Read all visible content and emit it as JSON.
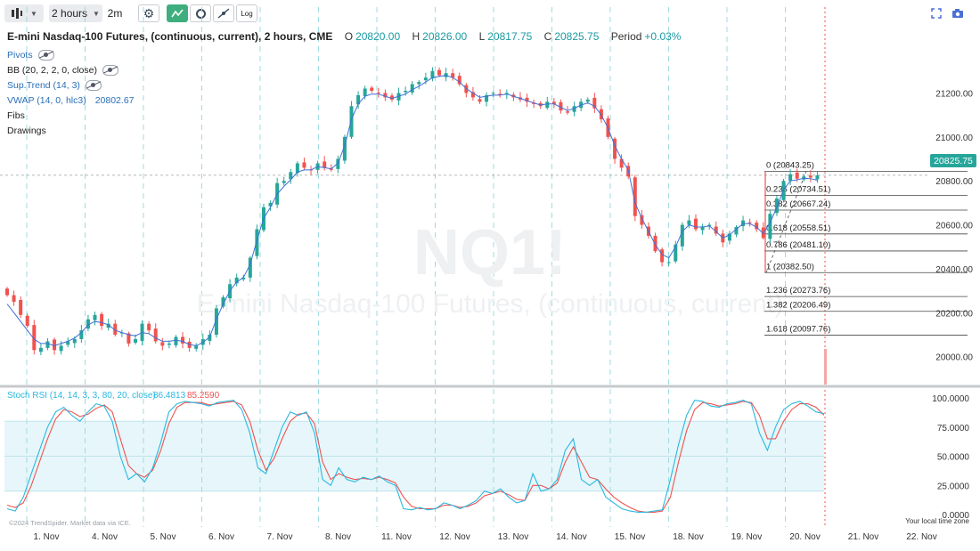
{
  "toolbar": {
    "interval": "2 hours",
    "refresh": "2m",
    "log_label": "Log"
  },
  "header": {
    "title": "E-mini Nasdaq-100 Futures, (continuous, current), 2 hours, CME",
    "o_label": "O",
    "o_value": "20820.00",
    "h_label": "H",
    "h_value": "20826.00",
    "l_label": "L",
    "l_value": "20817.75",
    "c_label": "C",
    "c_value": "20825.75",
    "period_label": "Period",
    "period_value": "+0.03%"
  },
  "indicators": {
    "pivots": "Pivots",
    "bb": "BB (20, 2, 2, 0, close)",
    "supertrend": "Sup.Trend (14, 3)",
    "vwap": "VWAP (14, 0, hlc3)",
    "vwap_value": "20802.67",
    "fibs": "Fibs",
    "drawings": "Drawings"
  },
  "watermark": {
    "symbol": "NQ1!",
    "name": "E-mini Nasdaq-100 Futures, (continuous, current)"
  },
  "price_label": "20825.75",
  "stoch_legend": {
    "text": "Stoch RSI (14, 14, 3, 3, 80, 20, close)",
    "k_value": "86.4813",
    "d_value": "85.2590"
  },
  "copyright": "©2024 TrendSpider. Market data via ICE.",
  "timezone_note": "Your local time zone",
  "colors": {
    "up": "#26a69a",
    "down": "#ef5350",
    "vwap": "#3f6fd6",
    "stoch_k": "#2ab8e0",
    "stoch_d": "#ef5350",
    "band_fill": "#e6f6fa",
    "accent": "#3fae7e"
  },
  "chart_data": {
    "type": "candlestick",
    "x_ticks": [
      "1. Nov",
      "4. Nov",
      "5. Nov",
      "6. Nov",
      "7. Nov",
      "8. Nov",
      "11. Nov",
      "12. Nov",
      "13. Nov",
      "14. Nov",
      "15. Nov",
      "18. Nov",
      "19. Nov",
      "20. Nov",
      "21. Nov",
      "22. Nov"
    ],
    "price_ticks": [
      "21200.00",
      "21000.00",
      "20800.00",
      "20600.00",
      "20400.00",
      "20200.00",
      "20000.00"
    ],
    "ylim": [
      19930,
      21380
    ],
    "last_price": 20825.75,
    "series": [
      {
        "name": "Price",
        "values": [
          20280,
          20250,
          20190,
          20140,
          20030,
          20040,
          20070,
          20030,
          20050,
          20070,
          20080,
          20120,
          20170,
          20190,
          20140,
          20150,
          20100,
          20110,
          20060,
          20080,
          20150,
          20120,
          20070,
          20050,
          20060,
          20090,
          20060,
          20040,
          20050,
          20080,
          20100,
          20220,
          20270,
          20330,
          20360,
          20360,
          20450,
          20580,
          20680,
          20700,
          20790,
          20800,
          20840,
          20880,
          20860,
          20850,
          20880,
          20860,
          20850,
          20900,
          21000,
          21140,
          21190,
          21220,
          21210,
          21200,
          21180,
          21170,
          21200,
          21210,
          21240,
          21250,
          21270,
          21300,
          21280,
          21290,
          21270,
          21240,
          21200,
          21180,
          21160,
          21190,
          21200,
          21190,
          21200,
          21180,
          21170,
          21160,
          21150,
          21140,
          21160,
          21150,
          21120,
          21110,
          21140,
          21160,
          21170,
          21130,
          21080,
          21000,
          20900,
          20860,
          20820,
          20640,
          20600,
          20550,
          20480,
          20430,
          20430,
          20510,
          20600,
          20620,
          20580,
          20590,
          20600,
          20560,
          20520,
          20560,
          20590,
          20620,
          20610,
          20580,
          20540,
          20650,
          20720,
          20800,
          20830,
          20810,
          20820,
          20815,
          20825
        ]
      },
      {
        "name": "VWAP",
        "values": [
          20240,
          20200,
          20160,
          20120,
          20080,
          20060,
          20060,
          20050,
          20060,
          20070,
          20085,
          20110,
          20145,
          20160,
          20155,
          20145,
          20120,
          20110,
          20100,
          20095,
          20110,
          20105,
          20085,
          20070,
          20070,
          20075,
          20070,
          20055,
          20050,
          20065,
          20090,
          20170,
          20240,
          20300,
          20340,
          20360,
          20420,
          20530,
          20630,
          20680,
          20740,
          20775,
          20805,
          20840,
          20850,
          20850,
          20865,
          20860,
          20855,
          20880,
          20960,
          21080,
          21150,
          21185,
          21195,
          21195,
          21185,
          21175,
          21185,
          21195,
          21215,
          21230,
          21250,
          21270,
          21275,
          21280,
          21270,
          21250,
          21220,
          21200,
          21180,
          21185,
          21190,
          21190,
          21195,
          21185,
          21175,
          21165,
          21155,
          21145,
          21150,
          21150,
          21135,
          21120,
          21130,
          21145,
          21155,
          21140,
          21100,
          21040,
          20960,
          20900,
          20850,
          20700,
          20630,
          20570,
          20510,
          20465,
          20450,
          20500,
          20570,
          20600,
          20590,
          20590,
          20595,
          20570,
          20540,
          20555,
          20580,
          20605,
          20605,
          20590,
          20560,
          20610,
          20680,
          20760,
          20800,
          20805,
          20812,
          20810,
          20802.67
        ]
      }
    ],
    "fib_levels": [
      {
        "ratio": "0",
        "price": 20843.25
      },
      {
        "ratio": "0.236",
        "price": 20734.51
      },
      {
        "ratio": "0.382",
        "price": 20667.24
      },
      {
        "ratio": "0.618",
        "price": 20558.51
      },
      {
        "ratio": "0.786",
        "price": 20481.1
      },
      {
        "ratio": "1",
        "price": 20382.5
      },
      {
        "ratio": "1.236",
        "price": 20273.76
      },
      {
        "ratio": "1.382",
        "price": 20206.49
      },
      {
        "ratio": "1.618",
        "price": 20097.76
      }
    ],
    "stoch_ticks": [
      "100.0000",
      "75.0000",
      "50.0000",
      "25.0000",
      "0.0000"
    ],
    "stoch_band": [
      20,
      80
    ],
    "stoch_k": [
      5,
      3,
      15,
      35,
      55,
      75,
      88,
      92,
      85,
      80,
      88,
      95,
      93,
      80,
      50,
      30,
      35,
      28,
      40,
      62,
      88,
      95,
      97,
      96,
      95,
      93,
      96,
      97,
      98,
      90,
      70,
      40,
      35,
      55,
      75,
      88,
      85,
      88,
      70,
      30,
      25,
      40,
      30,
      28,
      32,
      30,
      33,
      28,
      25,
      5,
      4,
      6,
      4,
      5,
      10,
      8,
      5,
      8,
      12,
      20,
      18,
      22,
      15,
      10,
      12,
      35,
      20,
      22,
      30,
      55,
      65,
      30,
      25,
      30,
      15,
      10,
      5,
      3,
      2,
      2,
      3,
      4,
      30,
      60,
      85,
      98,
      97,
      93,
      92,
      95,
      96,
      98,
      95,
      70,
      55,
      75,
      90,
      95,
      97,
      93,
      88,
      86.48
    ],
    "stoch_d": [
      8,
      6,
      10,
      25,
      45,
      65,
      82,
      90,
      88,
      84,
      86,
      91,
      94,
      88,
      65,
      42,
      35,
      32,
      38,
      55,
      78,
      92,
      96,
      96,
      96,
      94,
      95,
      96,
      97,
      94,
      80,
      55,
      38,
      48,
      65,
      80,
      86,
      87,
      78,
      45,
      30,
      35,
      32,
      30,
      31,
      30,
      32,
      30,
      27,
      15,
      7,
      5,
      5,
      5,
      8,
      8,
      6,
      7,
      10,
      16,
      18,
      20,
      17,
      13,
      12,
      25,
      25,
      22,
      27,
      45,
      58,
      45,
      32,
      30,
      22,
      15,
      10,
      6,
      3,
      2,
      2,
      3,
      15,
      45,
      72,
      90,
      96,
      95,
      93,
      94,
      95,
      97,
      96,
      85,
      65,
      65,
      80,
      90,
      95,
      95,
      92,
      85.26
    ]
  }
}
